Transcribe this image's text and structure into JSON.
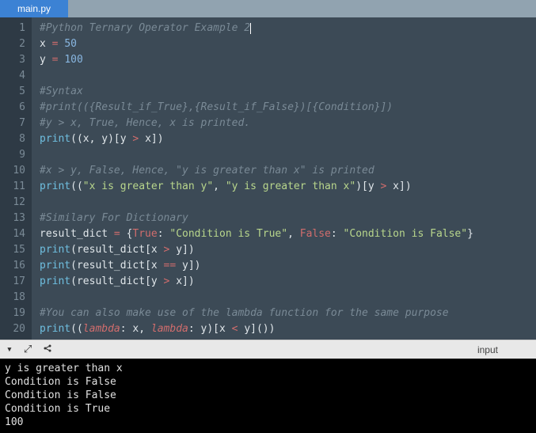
{
  "tab": {
    "name": "main.py"
  },
  "editor": {
    "lines": [
      {
        "num": "1",
        "tokens": [
          [
            "c-comment",
            "#Python Ternary Operator Example 2"
          ]
        ]
      },
      {
        "num": "2",
        "tokens": [
          [
            "c-var",
            "x "
          ],
          [
            "c-op",
            "="
          ],
          [
            "c-var",
            " "
          ],
          [
            "c-num",
            "50"
          ]
        ]
      },
      {
        "num": "3",
        "tokens": [
          [
            "c-var",
            "y "
          ],
          [
            "c-op",
            "="
          ],
          [
            "c-var",
            " "
          ],
          [
            "c-num",
            "100"
          ]
        ]
      },
      {
        "num": "4",
        "tokens": []
      },
      {
        "num": "5",
        "tokens": [
          [
            "c-comment",
            "#Syntax"
          ]
        ]
      },
      {
        "num": "6",
        "tokens": [
          [
            "c-comment",
            "#print(({Result_if_True},{Result_if_False})[{Condition}])"
          ]
        ]
      },
      {
        "num": "7",
        "tokens": [
          [
            "c-comment",
            "#y > x, True, Hence, x is printed."
          ]
        ]
      },
      {
        "num": "8",
        "tokens": [
          [
            "c-fn",
            "print"
          ],
          [
            "c-paren",
            "(("
          ],
          [
            "c-var",
            "x"
          ],
          [
            "c-paren",
            ", "
          ],
          [
            "c-var",
            "y"
          ],
          [
            "c-paren",
            ")["
          ],
          [
            "c-var",
            "y "
          ],
          [
            "c-op",
            ">"
          ],
          [
            "c-var",
            " x"
          ],
          [
            "c-paren",
            "])"
          ]
        ]
      },
      {
        "num": "9",
        "tokens": []
      },
      {
        "num": "10",
        "tokens": [
          [
            "c-comment",
            "#x > y, False, Hence, \"y is greater than x\" is printed"
          ]
        ]
      },
      {
        "num": "11",
        "tokens": [
          [
            "c-fn",
            "print"
          ],
          [
            "c-paren",
            "(("
          ],
          [
            "c-str",
            "\"x is greater than y\""
          ],
          [
            "c-paren",
            ", "
          ],
          [
            "c-str",
            "\"y is greater than x\""
          ],
          [
            "c-paren",
            ")["
          ],
          [
            "c-var",
            "y "
          ],
          [
            "c-op",
            ">"
          ],
          [
            "c-var",
            " x"
          ],
          [
            "c-paren",
            "])"
          ]
        ]
      },
      {
        "num": "12",
        "tokens": []
      },
      {
        "num": "13",
        "tokens": [
          [
            "c-comment",
            "#Similary For Dictionary"
          ]
        ]
      },
      {
        "num": "14",
        "tokens": [
          [
            "c-var",
            "result_dict "
          ],
          [
            "c-op",
            "="
          ],
          [
            "c-var",
            " "
          ],
          [
            "c-paren",
            "{"
          ],
          [
            "c-bool",
            "True"
          ],
          [
            "c-paren",
            ": "
          ],
          [
            "c-str",
            "\"Condition is True\""
          ],
          [
            "c-paren",
            ", "
          ],
          [
            "c-bool",
            "False"
          ],
          [
            "c-paren",
            ": "
          ],
          [
            "c-str",
            "\"Condition is False\""
          ],
          [
            "c-paren",
            "}"
          ]
        ]
      },
      {
        "num": "15",
        "tokens": [
          [
            "c-fn",
            "print"
          ],
          [
            "c-paren",
            "("
          ],
          [
            "c-var",
            "result_dict"
          ],
          [
            "c-paren",
            "["
          ],
          [
            "c-var",
            "x "
          ],
          [
            "c-op",
            ">"
          ],
          [
            "c-var",
            " y"
          ],
          [
            "c-paren",
            "])"
          ]
        ]
      },
      {
        "num": "16",
        "tokens": [
          [
            "c-fn",
            "print"
          ],
          [
            "c-paren",
            "("
          ],
          [
            "c-var",
            "result_dict"
          ],
          [
            "c-paren",
            "["
          ],
          [
            "c-var",
            "x "
          ],
          [
            "c-op",
            "=="
          ],
          [
            "c-var",
            " y"
          ],
          [
            "c-paren",
            "])"
          ]
        ]
      },
      {
        "num": "17",
        "tokens": [
          [
            "c-fn",
            "print"
          ],
          [
            "c-paren",
            "("
          ],
          [
            "c-var",
            "result_dict"
          ],
          [
            "c-paren",
            "["
          ],
          [
            "c-var",
            "y "
          ],
          [
            "c-op",
            ">"
          ],
          [
            "c-var",
            " x"
          ],
          [
            "c-paren",
            "])"
          ]
        ]
      },
      {
        "num": "18",
        "tokens": []
      },
      {
        "num": "19",
        "tokens": [
          [
            "c-comment",
            "#You can also make use of the lambda function for the same purpose"
          ]
        ]
      },
      {
        "num": "20",
        "tokens": [
          [
            "c-fn",
            "print"
          ],
          [
            "c-paren",
            "(("
          ],
          [
            "c-kw",
            "lambda"
          ],
          [
            "c-paren",
            ": "
          ],
          [
            "c-var",
            "x"
          ],
          [
            "c-paren",
            ", "
          ],
          [
            "c-kw",
            "lambda"
          ],
          [
            "c-paren",
            ": "
          ],
          [
            "c-var",
            "y"
          ],
          [
            "c-paren",
            ")["
          ],
          [
            "c-var",
            "x "
          ],
          [
            "c-op",
            "<"
          ],
          [
            "c-var",
            " y"
          ],
          [
            "c-paren",
            "]())"
          ]
        ]
      }
    ]
  },
  "console_toolbar": {
    "icons": [
      "caret-down",
      "expand",
      "share"
    ],
    "input_label": "input"
  },
  "console": {
    "output": [
      "y is greater than x",
      "Condition is False",
      "Condition is False",
      "Condition is True",
      "100"
    ]
  }
}
